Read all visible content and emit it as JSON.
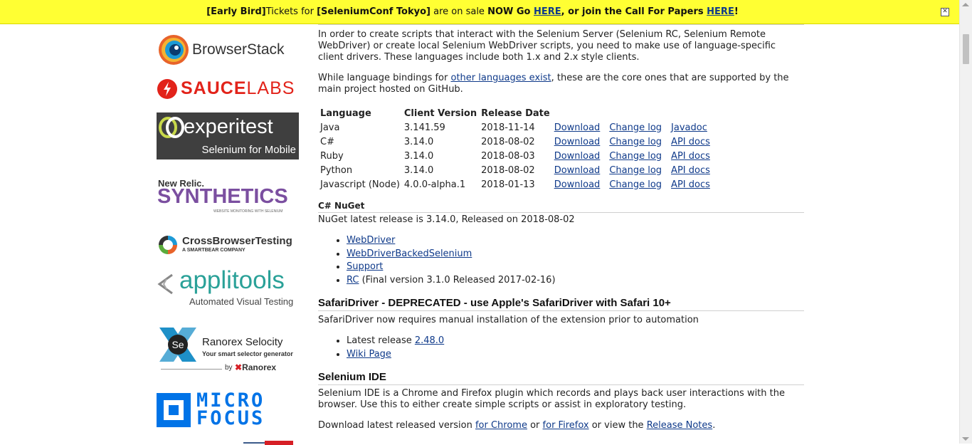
{
  "banner": {
    "prefix": "[Early Bird]",
    "text1": "Tickets for ",
    "conf": "[SeleniumConf Tokyo]",
    "text2": " are on sale ",
    "now": "NOW Go ",
    "here1": "HERE",
    "text3": ", or join the Call For Papers ",
    "here2": "HERE",
    "end": "!",
    "close": "✕"
  },
  "sponsors": {
    "browserstack": "BrowserStack",
    "saucelabs_a": "SAUCE",
    "saucelabs_b": "LABS",
    "experitest": "experitest",
    "experitest_sub": "Selenium for Mobile",
    "newrelic": "New Relic.",
    "synthetics": "SYNTHETICS",
    "synthetics_sub": "WEBSITE MONITORING WITH SELENIUM",
    "cbt": "CrossBrowserTesting",
    "cbt_sub": "A SMARTBEAR COMPANY",
    "applitools": "applitools",
    "applitools_sub": "Automated Visual Testing",
    "ranorex_title": "Ranorex Selocity",
    "ranorex_sub": "Your smart selector generator",
    "ranorex_by": "by",
    "ranorex_brand": "Ranorex",
    "microfocus_1": "MICRO",
    "microfocus_2": "FOCUS"
  },
  "intro": {
    "p1": "In order to create scripts that interact with the Selenium Server (Selenium RC, Selenium Remote WebDriver) or create local Selenium WebDriver scripts, you need to make use of language-specific client drivers. These languages include both 1.x and 2.x style clients.",
    "p2_a": "While language bindings for ",
    "p2_link": "other languages exist",
    "p2_b": ", these are the core ones that are supported by the main project hosted on GitHub."
  },
  "table": {
    "headers": [
      "Language",
      "Client Version",
      "Release Date"
    ],
    "rows": [
      {
        "language": "Java",
        "version": "3.141.59",
        "date": "2018-11-14",
        "download": "Download",
        "changelog": "Change log",
        "docs": "Javadoc"
      },
      {
        "language": "C#",
        "version": "3.14.0",
        "date": "2018-08-02",
        "download": "Download",
        "changelog": "Change log",
        "docs": "API docs"
      },
      {
        "language": "Ruby",
        "version": "3.14.0",
        "date": "2018-08-03",
        "download": "Download",
        "changelog": "Change log",
        "docs": "API docs"
      },
      {
        "language": "Python",
        "version": "3.14.0",
        "date": "2018-08-02",
        "download": "Download",
        "changelog": "Change log",
        "docs": "API docs"
      },
      {
        "language": "Javascript (Node)",
        "version": "4.0.0-alpha.1",
        "date": "2018-01-13",
        "download": "Download",
        "changelog": "Change log",
        "docs": "API docs"
      }
    ]
  },
  "nuget": {
    "title": "C# NuGet",
    "text": "NuGet latest release is 3.14.0, Released on 2018-08-02",
    "items": [
      "WebDriver",
      "WebDriverBackedSelenium",
      "Support",
      "RC"
    ],
    "rc_note": " (Final version 3.1.0 Released 2017-02-16)"
  },
  "safari": {
    "title": "SafariDriver - DEPRECATED - use Apple's SafariDriver with Safari 10+",
    "text": "SafariDriver now requires manual installation of the extension prior to automation",
    "latest_label": "Latest release ",
    "latest_link": "2.48.0",
    "wiki": "Wiki Page"
  },
  "ide": {
    "title": "Selenium IDE",
    "text": "Selenium IDE is a Chrome and Firefox plugin which records and plays back user interactions with the browser. Use this to either create simple scripts or assist in exploratory testing.",
    "dl_a": "Download latest released version ",
    "dl_chrome": "for Chrome",
    "dl_or": " or ",
    "dl_firefox": "for Firefox",
    "dl_view": " or view the ",
    "dl_notes": "Release Notes",
    "dl_end": "."
  }
}
